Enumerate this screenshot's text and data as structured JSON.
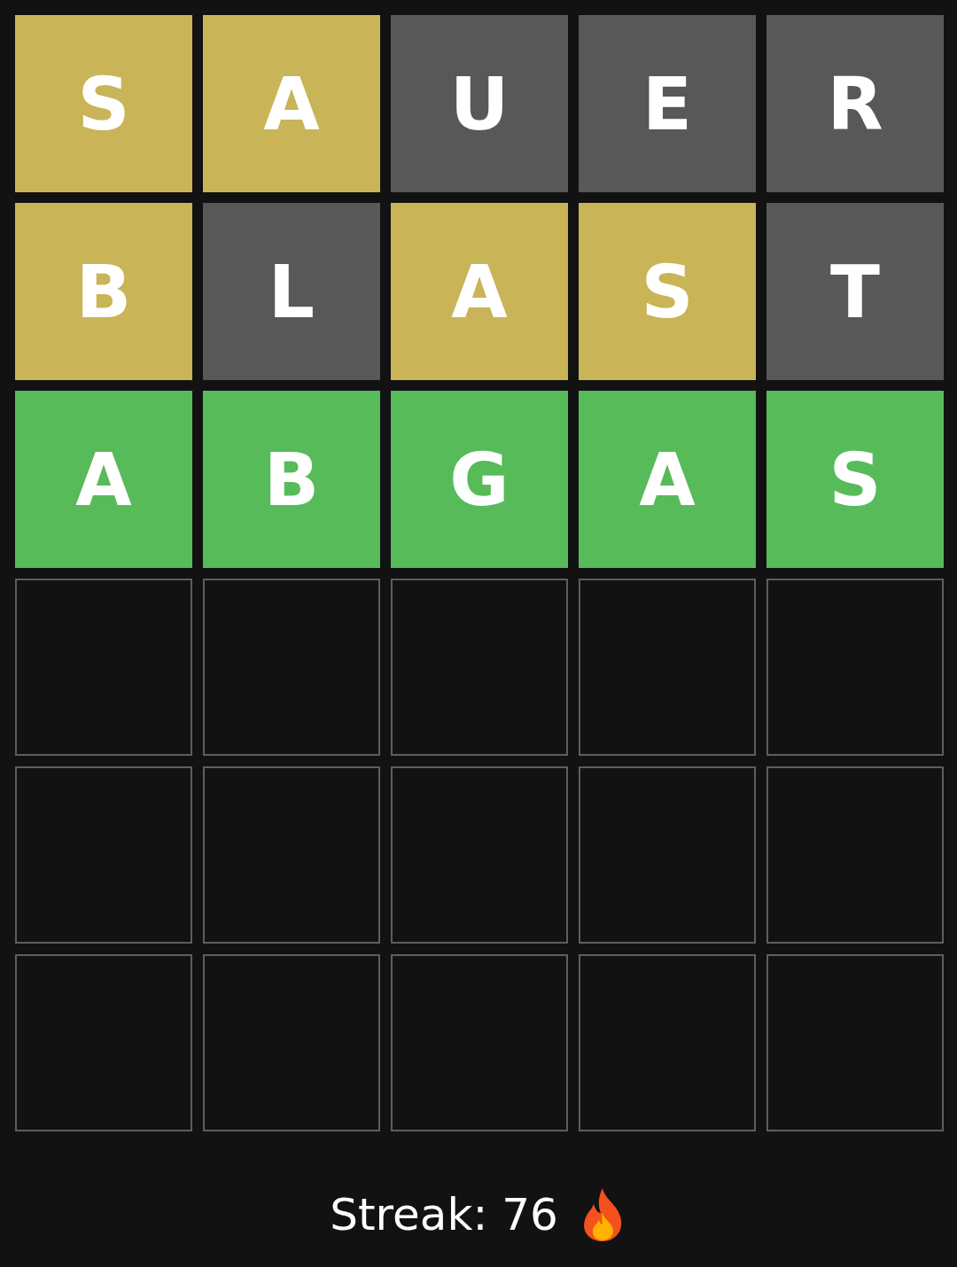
{
  "board": [
    {
      "tiles": [
        {
          "letter": "S",
          "kind": "present"
        },
        {
          "letter": "A",
          "kind": "present"
        },
        {
          "letter": "U",
          "kind": "absent"
        },
        {
          "letter": "E",
          "kind": "absent"
        },
        {
          "letter": "R",
          "kind": "absent"
        }
      ]
    },
    {
      "tiles": [
        {
          "letter": "B",
          "kind": "present"
        },
        {
          "letter": "L",
          "kind": "absent"
        },
        {
          "letter": "A",
          "kind": "present"
        },
        {
          "letter": "S",
          "kind": "present"
        },
        {
          "letter": "T",
          "kind": "absent"
        }
      ]
    },
    {
      "tiles": [
        {
          "letter": "A",
          "kind": "correct"
        },
        {
          "letter": "B",
          "kind": "correct"
        },
        {
          "letter": "G",
          "kind": "correct"
        },
        {
          "letter": "A",
          "kind": "correct"
        },
        {
          "letter": "S",
          "kind": "correct"
        }
      ]
    },
    {
      "tiles": [
        {
          "kind": "empty"
        },
        {
          "kind": "empty"
        },
        {
          "kind": "empty"
        },
        {
          "kind": "empty"
        },
        {
          "kind": "empty"
        }
      ]
    },
    {
      "tiles": [
        {
          "kind": "empty"
        },
        {
          "kind": "empty"
        },
        {
          "kind": "empty"
        },
        {
          "kind": "empty"
        },
        {
          "kind": "empty"
        }
      ]
    },
    {
      "tiles": [
        {
          "kind": "empty"
        },
        {
          "kind": "empty"
        },
        {
          "kind": "empty"
        },
        {
          "kind": "empty"
        },
        {
          "kind": "empty"
        }
      ]
    }
  ],
  "streak": {
    "label": "Streak: 76"
  }
}
